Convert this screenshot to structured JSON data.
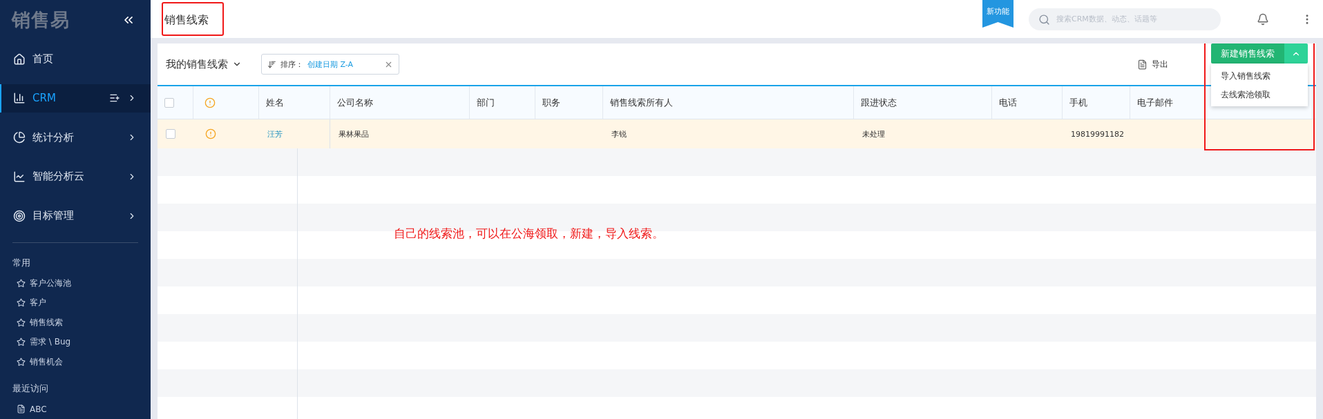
{
  "sidebar": {
    "logo": "销售易",
    "nav": [
      {
        "label": "首页",
        "selected": false,
        "expandable": false
      },
      {
        "label": "CRM",
        "selected": true,
        "expandable": true
      },
      {
        "label": "统计分析",
        "selected": false,
        "expandable": true
      },
      {
        "label": "智能分析云",
        "selected": false,
        "expandable": true
      },
      {
        "label": "目标管理",
        "selected": false,
        "expandable": true
      }
    ],
    "favorites": {
      "title": "常用",
      "items": [
        "客户公海池",
        "客户",
        "销售线索",
        "需求 \\ Bug",
        "销售机会"
      ]
    },
    "recent": {
      "title": "最近访问",
      "items": [
        "ABC"
      ]
    }
  },
  "header": {
    "title": "销售线索",
    "badge": "新功能",
    "search": {
      "placeholder": "搜索CRM数据、动态、话题等"
    }
  },
  "toolbar": {
    "view": "我的销售线索",
    "sort": {
      "label": "排序：",
      "value": "创建日期 Z-A"
    },
    "export": "导出",
    "primary_button": "新建销售线索",
    "menu": [
      "导入销售线索",
      "去线索池领取"
    ]
  },
  "table": {
    "all_checked": false,
    "columns": [
      "姓名",
      "公司名称",
      "部门",
      "职务",
      "销售线索所有人",
      "跟进状态",
      "电话",
      "手机",
      "电子邮件"
    ],
    "rows": [
      {
        "checked": false,
        "cells": [
          "汪芳",
          "果林果品",
          null,
          null,
          "李锐",
          "未处理",
          null,
          "19819991182",
          null
        ]
      }
    ]
  },
  "annotation": "自己的线索池，可以在公海领取，新建，导入线索。"
}
